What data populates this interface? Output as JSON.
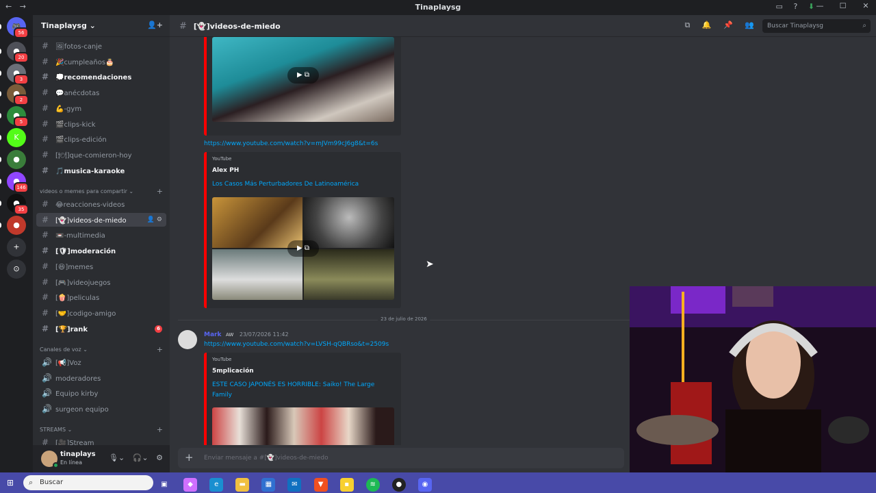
{
  "window": {
    "title": "Tinaplaysg",
    "nav_back": "←",
    "nav_fwd": "→",
    "minimize": "—",
    "maximize": "☐",
    "close": "✕"
  },
  "servers": [
    {
      "label": "🎮",
      "badge": "56",
      "color": "#5865f2"
    },
    {
      "label": "●",
      "badge": "20",
      "color": "#4e5058"
    },
    {
      "label": "●",
      "badge": "3",
      "color": "#6b6f78"
    },
    {
      "label": "●",
      "badge": "2",
      "color": "#7a5c3a"
    },
    {
      "label": "●",
      "badge": "5",
      "color": "#2d8c3c"
    },
    {
      "label": "K",
      "badge": "",
      "color": "#53fc18"
    },
    {
      "label": "●",
      "badge": "",
      "color": "#3a7d3a"
    },
    {
      "label": "●",
      "badge": "146",
      "color": "#9146ff"
    },
    {
      "label": "●",
      "badge": "35",
      "color": "#101010"
    },
    {
      "label": "●",
      "badge": "",
      "color": "#c0392b"
    },
    {
      "label": "+",
      "badge": "",
      "color": "#313338"
    },
    {
      "label": "⊙",
      "badge": "",
      "color": "#313338"
    }
  ],
  "guild": {
    "name": "Tinaplaysg ⌄"
  },
  "channels_top": [
    {
      "label": "🖼fotos-canje",
      "bold": false
    },
    {
      "label": "🎉cumpleaños🎂",
      "bold": false
    },
    {
      "label": "💭recomendaciones",
      "bold": true
    },
    {
      "label": "💬anécdotas",
      "bold": false
    },
    {
      "label": "💪-gym",
      "bold": false
    },
    {
      "label": "🎬clips-kick",
      "bold": false
    },
    {
      "label": "🎬clips-edición",
      "bold": false
    },
    {
      "label": "[🍽]que-comieron-hoy",
      "bold": false
    },
    {
      "label": "🎵musica-karaoke",
      "bold": true
    }
  ],
  "category_memes": "videos o memes para compartir ⌄",
  "channels_memes": [
    {
      "label": "😂reacciones-videos",
      "bold": false,
      "active": false,
      "badge": ""
    },
    {
      "label": "[👻]videos-de-miedo",
      "bold": false,
      "active": true,
      "badge": ""
    },
    {
      "label": "📼-multimedia",
      "bold": false,
      "active": false,
      "badge": ""
    },
    {
      "label": "[🛡]moderación",
      "bold": true,
      "active": false,
      "badge": ""
    },
    {
      "label": "[😆]memes",
      "bold": false,
      "active": false,
      "badge": ""
    },
    {
      "label": "[🎮]videojuegos",
      "bold": false,
      "active": false,
      "badge": ""
    },
    {
      "label": "[🍿]peliculas",
      "bold": false,
      "active": false,
      "badge": ""
    },
    {
      "label": "[🤝]codigo-amigo",
      "bold": false,
      "active": false,
      "badge": ""
    },
    {
      "label": "[🏆]rank",
      "bold": true,
      "active": false,
      "badge": "6"
    }
  ],
  "category_voice": "Canales de voz ⌄",
  "voice_channels": [
    "[📢]Voz",
    "moderadores",
    "Equipo kirby",
    "surgeon equipo"
  ],
  "category_streams": "STREAMS ⌄",
  "stream_channels": [
    "[🎥]Stream"
  ],
  "user": {
    "name": "tinaplays",
    "status": "En línea"
  },
  "topbar": {
    "channel": "[👻]videos-de-miedo",
    "search_placeholder": "Buscar Tinaplaysg"
  },
  "messages": {
    "link1": "https://www.youtube.com/watch?v=mJVm99cJ6g8&t=6s",
    "embed2": {
      "provider": "YouTube",
      "author": "Alex PH",
      "title": "Los Casos Más Perturbadores De Latinoamérica"
    },
    "date_divider": "23 de julio de 2026",
    "msg3": {
      "user": "Mark",
      "tag": "AW",
      "time": "23/07/2026 11:42",
      "link": "https://www.youtube.com/watch?v=LVSH-qQBRso&t=2509s"
    },
    "embed3": {
      "provider": "YouTube",
      "author": "5mplicación",
      "title": "ESTE CASO JAPONÉS ES HORRIBLE: Saiko! The Large Family"
    }
  },
  "composer": {
    "placeholder": "Enviar mensaje a #[👻]videos-de-miedo"
  },
  "taskbar": {
    "search": "Buscar"
  },
  "colors": {
    "accent": "#5865f2",
    "link": "#00a8fc",
    "youtube": "#ff0000",
    "online": "#23a55a",
    "badge": "#f23f43",
    "taskbar": "#484aa8"
  }
}
